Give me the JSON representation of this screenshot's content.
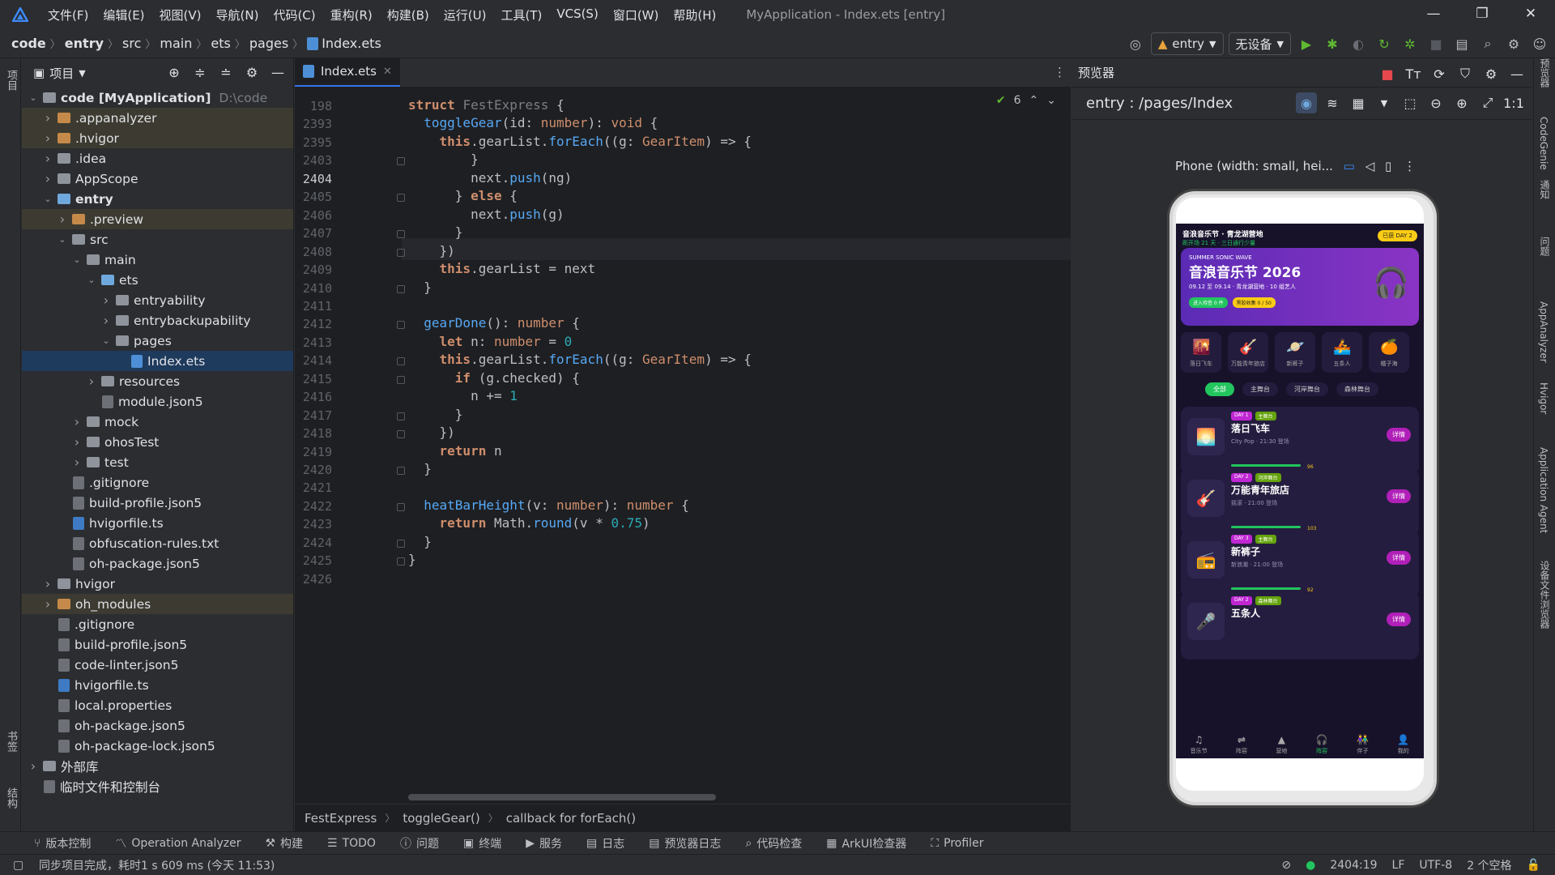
{
  "menubar": {
    "items": [
      "文件(F)",
      "编辑(E)",
      "视图(V)",
      "导航(N)",
      "代码(C)",
      "重构(R)",
      "构建(B)",
      "运行(U)",
      "工具(T)",
      "VCS(S)",
      "窗口(W)",
      "帮助(H)"
    ],
    "window_title": "MyApplication - Index.ets [entry]"
  },
  "breadcrumbs": [
    "code",
    "entry",
    "src",
    "main",
    "ets",
    "pages",
    "Index.ets"
  ],
  "toolbar": {
    "run_config": "entry",
    "device": "无设备"
  },
  "left_strip": {
    "project_label": "项目",
    "bookmarks_label": "书签",
    "structure_label": "结构"
  },
  "project_panel": {
    "title": "项目",
    "tree": [
      {
        "d": 0,
        "exp": "open",
        "icon": "folder-g",
        "label": "code [MyApplication]",
        "extra": "D:\\code",
        "bold": true
      },
      {
        "d": 1,
        "exp": "closed",
        "icon": "folder-o",
        "label": ".appanalyzer",
        "hl": true
      },
      {
        "d": 1,
        "exp": "closed",
        "icon": "folder-o",
        "label": ".hvigor",
        "hl": true
      },
      {
        "d": 1,
        "exp": "closed",
        "icon": "folder-g",
        "label": ".idea"
      },
      {
        "d": 1,
        "exp": "closed",
        "icon": "folder-g",
        "label": "AppScope"
      },
      {
        "d": 1,
        "exp": "open",
        "icon": "folder-b",
        "label": "entry",
        "bold": true
      },
      {
        "d": 2,
        "exp": "closed",
        "icon": "folder-o",
        "label": ".preview",
        "hl": true
      },
      {
        "d": 2,
        "exp": "open",
        "icon": "folder-g",
        "label": "src"
      },
      {
        "d": 3,
        "exp": "open",
        "icon": "folder-g",
        "label": "main"
      },
      {
        "d": 4,
        "exp": "open",
        "icon": "folder-b",
        "label": "ets"
      },
      {
        "d": 5,
        "exp": "closed",
        "icon": "folder-g",
        "label": "entryability"
      },
      {
        "d": 5,
        "exp": "closed",
        "icon": "folder-g",
        "label": "entrybackupability"
      },
      {
        "d": 5,
        "exp": "open",
        "icon": "folder-g",
        "label": "pages"
      },
      {
        "d": 6,
        "exp": "none",
        "icon": "file-ets",
        "label": "Index.ets",
        "sel": true
      },
      {
        "d": 4,
        "exp": "closed",
        "icon": "folder-g",
        "label": "resources"
      },
      {
        "d": 4,
        "exp": "none",
        "icon": "file",
        "label": "module.json5"
      },
      {
        "d": 3,
        "exp": "closed",
        "icon": "folder-g",
        "label": "mock"
      },
      {
        "d": 3,
        "exp": "closed",
        "icon": "folder-g",
        "label": "ohosTest"
      },
      {
        "d": 3,
        "exp": "closed",
        "icon": "folder-g",
        "label": "test"
      },
      {
        "d": 2,
        "exp": "none",
        "icon": "file",
        "label": ".gitignore"
      },
      {
        "d": 2,
        "exp": "none",
        "icon": "file",
        "label": "build-profile.json5"
      },
      {
        "d": 2,
        "exp": "none",
        "icon": "file-ts",
        "label": "hvigorfile.ts"
      },
      {
        "d": 2,
        "exp": "none",
        "icon": "file",
        "label": "obfuscation-rules.txt"
      },
      {
        "d": 2,
        "exp": "none",
        "icon": "file",
        "label": "oh-package.json5"
      },
      {
        "d": 1,
        "exp": "closed",
        "icon": "folder-g",
        "label": "hvigor"
      },
      {
        "d": 1,
        "exp": "closed",
        "icon": "folder-o",
        "label": "oh_modules",
        "hl": true
      },
      {
        "d": 1,
        "exp": "none",
        "icon": "file",
        "label": ".gitignore"
      },
      {
        "d": 1,
        "exp": "none",
        "icon": "file",
        "label": "build-profile.json5"
      },
      {
        "d": 1,
        "exp": "none",
        "icon": "file",
        "label": "code-linter.json5"
      },
      {
        "d": 1,
        "exp": "none",
        "icon": "file-ts",
        "label": "hvigorfile.ts"
      },
      {
        "d": 1,
        "exp": "none",
        "icon": "file",
        "label": "local.properties"
      },
      {
        "d": 1,
        "exp": "none",
        "icon": "file",
        "label": "oh-package.json5"
      },
      {
        "d": 1,
        "exp": "none",
        "icon": "file",
        "label": "oh-package-lock.json5"
      },
      {
        "d": 0,
        "exp": "closed",
        "icon": "lib",
        "label": "外部库"
      },
      {
        "d": 0,
        "exp": "none",
        "icon": "scratch",
        "label": "临时文件和控制台"
      }
    ]
  },
  "editor": {
    "tab": "Index.ets",
    "warnings": "6",
    "current_line": "2404",
    "lines": [
      {
        "n": "198",
        "code": "<span class=\"kw\">struct</span> <span class=\"fest\">FestExpress</span> {"
      },
      {
        "n": "2393",
        "code": "  <span class=\"fn\">toggleGear</span>(id: <span class=\"tyo\">number</span>): <span class=\"tyo\">void</span> {"
      },
      {
        "n": "2395",
        "code": "    <span class=\"kw\">this</span>.gearList.<span class=\"fn\">forEach</span>((g: <span class=\"tyo\">GearItem</span>) => {"
      },
      {
        "n": "2403",
        "code": "        }"
      },
      {
        "n": "2404",
        "code": "        next.<span class=\"fn\">push</span>(ng)"
      },
      {
        "n": "2405",
        "code": "      } <span class=\"kw\">else</span> {"
      },
      {
        "n": "2406",
        "code": "        next.<span class=\"fn\">push</span>(g)"
      },
      {
        "n": "2407",
        "code": "      }"
      },
      {
        "n": "2408",
        "code": "    })"
      },
      {
        "n": "2409",
        "code": "    <span class=\"kw\">this</span>.gearList = next"
      },
      {
        "n": "2410",
        "code": "  }"
      },
      {
        "n": "2411",
        "code": ""
      },
      {
        "n": "2412",
        "code": "  <span class=\"fn\">gearDone</span>(): <span class=\"tyo\">number</span> {"
      },
      {
        "n": "2413",
        "code": "    <span class=\"kw\">let</span> n: <span class=\"tyo\">number</span> = <span class=\"num\">0</span>"
      },
      {
        "n": "2414",
        "code": "    <span class=\"kw\">this</span>.gearList.<span class=\"fn\">forEach</span>((g: <span class=\"tyo\">GearItem</span>) => {"
      },
      {
        "n": "2415",
        "code": "      <span class=\"kw\">if</span> (g.checked) {"
      },
      {
        "n": "2416",
        "code": "        n += <span class=\"num\">1</span>"
      },
      {
        "n": "2417",
        "code": "      }"
      },
      {
        "n": "2418",
        "code": "    })"
      },
      {
        "n": "2419",
        "code": "    <span class=\"kw\">return</span> n"
      },
      {
        "n": "2420",
        "code": "  }"
      },
      {
        "n": "2421",
        "code": ""
      },
      {
        "n": "2422",
        "code": "  <span class=\"fn\">heatBarHeight</span>(v: <span class=\"tyo\">number</span>): <span class=\"tyo\">number</span> {"
      },
      {
        "n": "2423",
        "code": "    <span class=\"kw\">return</span> Math.<span class=\"fn\">round</span>(v * <span class=\"num\">0.75</span>)"
      },
      {
        "n": "2424",
        "code": "  }"
      },
      {
        "n": "2425",
        "code": "}"
      },
      {
        "n": "2426",
        "code": ""
      }
    ],
    "crumbs": [
      "FestExpress",
      "toggleGear()",
      "callback for forEach()"
    ]
  },
  "preview": {
    "title": "预览器",
    "path": "entry : /pages/Index",
    "device": "Phone (width: small, hei...",
    "app": {
      "header_title": "音浪音乐节 · 青龙湖营地",
      "header_sub": "距开场 21 天 · 三日通行少量",
      "badge": "已获 DAY 2",
      "banner_en": "SUMMER SONIC WAVE",
      "banner_title": "音浪音乐节 2026",
      "banner_sub": "09.12 至 09.14 · 青龙湖营地 · 10 组艺人",
      "banner_btn1": "进入待签 0 件",
      "banner_btn2": "黑胶收集 0 / 50",
      "icons": [
        "落日飞车",
        "万能青年旅店",
        "新裤子",
        "五条人",
        "橘子海"
      ],
      "chips": [
        "全部",
        "主舞台",
        "河岸舞台",
        "森林舞台"
      ],
      "cards": [
        {
          "day": "DAY 1",
          "tag": "主舞台",
          "name": "落日飞车",
          "sub": "City Pop · 21:30 登场",
          "btn": "详情",
          "score": "96"
        },
        {
          "day": "DAY 2",
          "tag": "河岸舞台",
          "name": "万能青年旅店",
          "sub": "摇滚 · 21:00 登场",
          "btn": "详情",
          "score": "103"
        },
        {
          "day": "DAY 3",
          "tag": "主舞台",
          "name": "新裤子",
          "sub": "新浪潮 · 21:00 登场",
          "btn": "详情",
          "score": "92"
        },
        {
          "day": "DAY 2",
          "tag": "森林舞台",
          "name": "五条人",
          "sub": "",
          "btn": "详情",
          "score": ""
        }
      ],
      "nav": [
        "音乐节",
        "阵容",
        "营地",
        "阵容",
        "伴子",
        "我的"
      ]
    }
  },
  "right_strip": [
    "预览器",
    "CodeGenie",
    "通知",
    "问题",
    "AppAnalyzer",
    "Hvigor",
    "Application Agent",
    "设备文件浏览器"
  ],
  "bottombar": [
    "版本控制",
    "Operation Analyzer",
    "构建",
    "TODO",
    "问题",
    "终端",
    "服务",
    "日志",
    "预览器日志",
    "代码检查",
    "ArkUI检查器",
    "Profiler"
  ],
  "status": {
    "message": "同步项目完成，耗时1 s 609 ms (今天 11:53)",
    "position": "2404:19",
    "line_sep": "LF",
    "encoding": "UTF-8",
    "indent": "2 个空格"
  },
  "colors": {
    "accent": "#3574f0",
    "keyword": "#cf8e6d",
    "function": "#56a8f5",
    "number": "#2aacb8"
  }
}
